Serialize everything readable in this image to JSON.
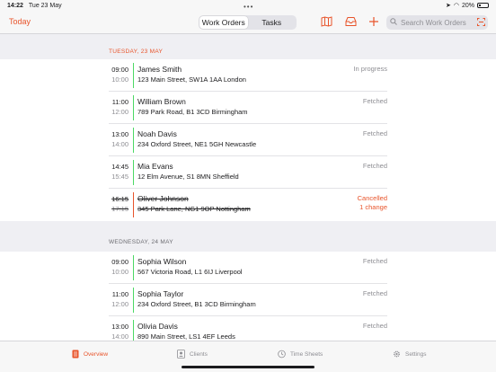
{
  "status_bar": {
    "time": "14:22",
    "date": "Tue 23 May",
    "battery": "20%"
  },
  "navbar": {
    "today_label": "Today",
    "segments": [
      "Work Orders",
      "Tasks"
    ],
    "selected_segment": "Work Orders",
    "search_placeholder": "Search Work Orders"
  },
  "colors": {
    "accent": "#e8542b",
    "status_bar_green": "#4cd964"
  },
  "sections": [
    {
      "header": "TUESDAY, 23 MAY",
      "orders": [
        {
          "start": "09:00",
          "end": "10:00",
          "name": "James Smith",
          "address": "123 Main Street, SW1A 1AA London",
          "status": "In progress"
        },
        {
          "start": "11:00",
          "end": "12:00",
          "name": "William Brown",
          "address": "789 Park Road, B1 3CD Birmingham",
          "status": "Fetched"
        },
        {
          "start": "13:00",
          "end": "14:00",
          "name": "Noah Davis",
          "address": "234 Oxford Street, NE1 5GH Newcastle",
          "status": "Fetched"
        },
        {
          "start": "14:45",
          "end": "15:45",
          "name": "Mia Evans",
          "address": "12 Elm Avenue, S1 8MN Sheffield",
          "status": "Fetched"
        },
        {
          "start": "16:15",
          "end": "17:15",
          "name": "Oliver Johnson",
          "address": "345 Park Lane, NG1 9OP Nottingham",
          "status": "Cancelled",
          "status_extra": "1 change"
        }
      ]
    },
    {
      "header": "WEDNESDAY, 24 MAY",
      "orders": [
        {
          "start": "09:00",
          "end": "10:00",
          "name": "Sophia Wilson",
          "address": "567 Victoria Road, L1 6IJ Liverpool",
          "status": "Fetched"
        },
        {
          "start": "11:00",
          "end": "12:00",
          "name": "Sophia Taylor",
          "address": "234 Oxford Street, B1 3CD Birmingham",
          "status": "Fetched"
        },
        {
          "start": "13:00",
          "end": "14:00",
          "name": "Olivia Davis",
          "address": "890 Main Street, LS1 4EF Leeds",
          "status": "Fetched"
        }
      ]
    }
  ],
  "tabbar": {
    "tabs": [
      {
        "label": "Overview",
        "icon": "overview-icon"
      },
      {
        "label": "Clients",
        "icon": "clients-icon"
      },
      {
        "label": "Time Sheets",
        "icon": "clock-icon"
      },
      {
        "label": "Settings",
        "icon": "gear-icon"
      }
    ],
    "selected": "Overview"
  }
}
